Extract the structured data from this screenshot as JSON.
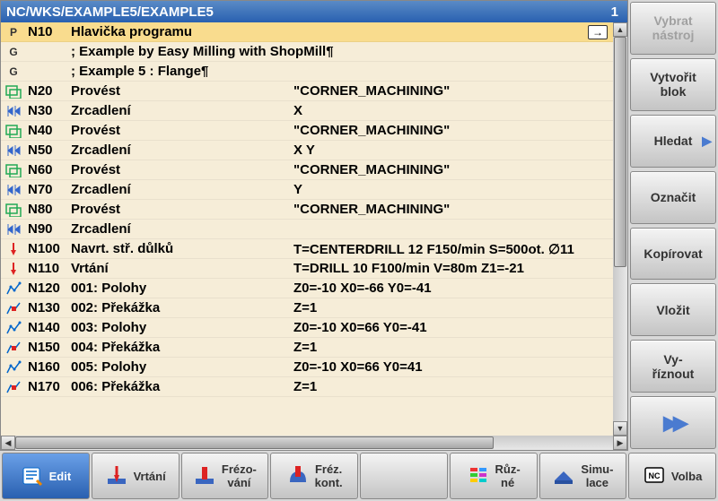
{
  "titlebar": {
    "path": "NC/WKS/EXAMPLE5/EXAMPLE5",
    "num": "1"
  },
  "program": {
    "rows": [
      {
        "icon": "P",
        "num": "N10",
        "name": "Hlavička programu",
        "param": "",
        "header": true,
        "arrow": true
      },
      {
        "icon": "G",
        "num": "",
        "name": "; Example by Easy Milling with ShopMill¶",
        "param": ""
      },
      {
        "icon": "G",
        "num": "",
        "name": "; Example 5 : Flange¶",
        "param": ""
      },
      {
        "icon": "sub",
        "num": "N20",
        "name": "Provést",
        "param": "\"CORNER_MACHINING\""
      },
      {
        "icon": "mir",
        "num": "N30",
        "name": "Zrcadlení",
        "param": "X"
      },
      {
        "icon": "sub",
        "num": "N40",
        "name": "Provést",
        "param": "\"CORNER_MACHINING\""
      },
      {
        "icon": "mir",
        "num": "N50",
        "name": "Zrcadlení",
        "param": "X Y"
      },
      {
        "icon": "sub",
        "num": "N60",
        "name": "Provést",
        "param": "\"CORNER_MACHINING\""
      },
      {
        "icon": "mir",
        "num": "N70",
        "name": "Zrcadlení",
        "param": "Y"
      },
      {
        "icon": "sub",
        "num": "N80",
        "name": "Provést",
        "param": "\"CORNER_MACHINING\""
      },
      {
        "icon": "mir",
        "num": "N90",
        "name": "Zrcadlení",
        "param": ""
      },
      {
        "icon": "drl",
        "num": "N100",
        "name": "Navrt. stř. důlků",
        "param": "T=CENTERDRILL 12 F150/min S=500ot. ∅11"
      },
      {
        "icon": "drl",
        "num": "N110",
        "name": "Vrtání",
        "param": "T=DRILL 10 F100/min V=80m Z1=-21"
      },
      {
        "icon": "pos",
        "num": "N120",
        "name": "001: Polohy",
        "param": "Z0=-10 X0=-66 Y0=-41"
      },
      {
        "icon": "obs",
        "num": "N130",
        "name": "002: Překážka",
        "param": "Z=1"
      },
      {
        "icon": "pos",
        "num": "N140",
        "name": "003: Polohy",
        "param": "Z0=-10 X0=66 Y0=-41"
      },
      {
        "icon": "obs",
        "num": "N150",
        "name": "004: Překážka",
        "param": "Z=1"
      },
      {
        "icon": "pos",
        "num": "N160",
        "name": "005: Polohy",
        "param": "Z0=-10 X0=66 Y0=41"
      },
      {
        "icon": "obs",
        "num": "N170",
        "name": "006: Překážka",
        "param": "Z=1"
      }
    ]
  },
  "softkeys_right": [
    {
      "label": "Vybrat\nnástroj",
      "disabled": true
    },
    {
      "label": "Vytvořit\nblok"
    },
    {
      "label": "Hledat",
      "chevron": true
    },
    {
      "label": "Označit"
    },
    {
      "label": "Kopírovat"
    },
    {
      "label": "Vložit"
    },
    {
      "label": "Vy-\nříznout"
    },
    {
      "label": "",
      "play": true
    }
  ],
  "bottom": [
    {
      "label": "Edit",
      "icon": "edit",
      "active": true
    },
    {
      "label": "Vrtání",
      "icon": "drill"
    },
    {
      "label": "Frézo-\nvání",
      "icon": "mill"
    },
    {
      "label": "Fréz.\nkont.",
      "icon": "contour"
    },
    {
      "label": "",
      "icon": ""
    },
    {
      "label": "Růz-\nné",
      "icon": "misc"
    },
    {
      "label": "Simu-\nlace",
      "icon": "sim"
    },
    {
      "label": "Volba",
      "icon": "nc"
    }
  ]
}
